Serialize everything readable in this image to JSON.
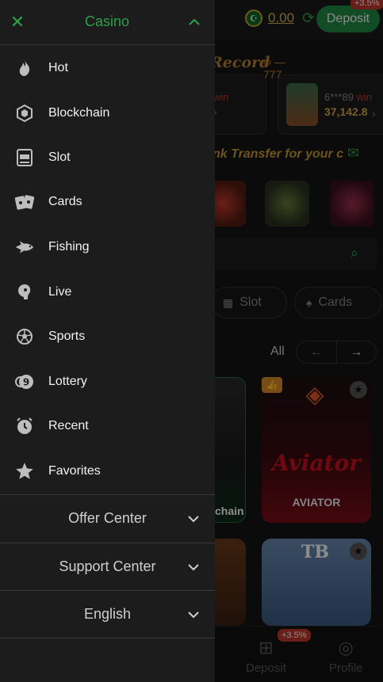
{
  "drawer": {
    "title": "Casino",
    "items": [
      {
        "label": "Hot",
        "icon": "fire-icon"
      },
      {
        "label": "Blockchain",
        "icon": "blockchain-cube-icon"
      },
      {
        "label": "Slot",
        "icon": "slot-machine-icon"
      },
      {
        "label": "Cards",
        "icon": "playing-cards-icon"
      },
      {
        "label": "Fishing",
        "icon": "fish-icon"
      },
      {
        "label": "Live",
        "icon": "live-dealer-icon"
      },
      {
        "label": "Sports",
        "icon": "soccer-ball-icon"
      },
      {
        "label": "Lottery",
        "icon": "lottery-ball-icon"
      },
      {
        "label": "Recent",
        "icon": "clock-icon"
      },
      {
        "label": "Favorites",
        "icon": "star-icon"
      }
    ],
    "sections": [
      {
        "label": "Offer Center"
      },
      {
        "label": "Support Center"
      },
      {
        "label": "English"
      }
    ]
  },
  "header": {
    "balance": "0.00",
    "deposit_label": "Deposit",
    "deposit_badge": "+3.5%"
  },
  "main": {
    "record_title": "Record",
    "wins": [
      {
        "text": "win"
      },
      {
        "user": "6***89",
        "label": "win",
        "amount": "37,142.8"
      }
    ],
    "transfer_banner": "nk Transfer for your c",
    "categories": [
      {
        "label": "Slot"
      },
      {
        "label": "Cards"
      }
    ],
    "all_label": "All",
    "games": [
      {
        "name": "chain"
      },
      {
        "name": "AVIATOR",
        "logo_text": "Aviator"
      },
      {
        "name": ""
      },
      {
        "name": "",
        "logo_text": "TB"
      }
    ]
  },
  "bottom_nav": {
    "deposit_label": "Deposit",
    "deposit_badge": "+3.5%",
    "profile_label": "Profile"
  },
  "colors": {
    "accent": "#2aa14a",
    "drawer_bg": "#1c1c1c",
    "gold": "#d9b64a"
  }
}
